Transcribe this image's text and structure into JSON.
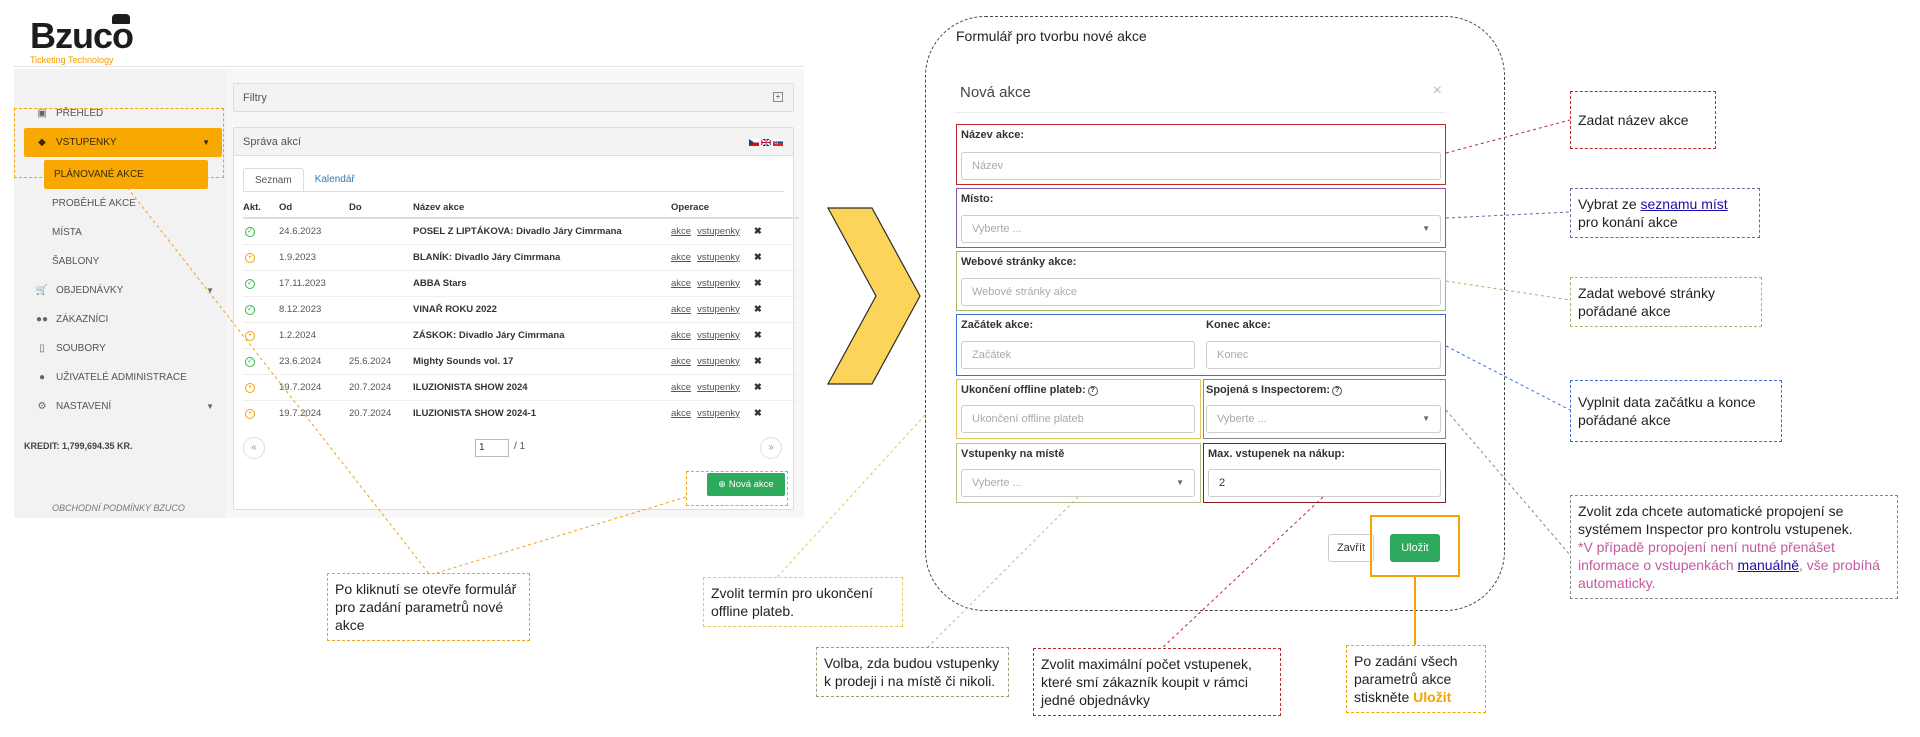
{
  "logo": {
    "name": "Bzuco",
    "tagline": "Ticketing Technology"
  },
  "sidebar": {
    "items": [
      {
        "label": "PŘEHLED",
        "icon": "dashboard-icon"
      },
      {
        "label": "VSTUPENKY",
        "icon": "ticket-icon"
      },
      {
        "label": "PLÁNOVANÉ AKCE"
      },
      {
        "label": "PROBĚHLÉ AKCE"
      },
      {
        "label": "MÍSTA"
      },
      {
        "label": "ŠABLONY"
      },
      {
        "label": "OBJEDNÁVKY",
        "icon": "cart-icon"
      },
      {
        "label": "ZÁKAZNÍCI",
        "icon": "users-icon"
      },
      {
        "label": "SOUBORY",
        "icon": "file-icon"
      },
      {
        "label": "UŽIVATELÉ ADMINISTRACE",
        "icon": "user-icon"
      },
      {
        "label": "NASTAVENÍ",
        "icon": "cogs-icon"
      }
    ],
    "credit": "KREDIT: 1,799,694.35 KR.",
    "terms": "OBCHODNÍ PODMÍNKY BZUCO"
  },
  "filters": {
    "title": "Filtry"
  },
  "events_panel": {
    "title": "Správa akcí",
    "tabs": [
      "Seznam",
      "Kalendář"
    ],
    "columns": [
      "Akt.",
      "Od",
      "Do",
      "Název akce",
      "Operace"
    ],
    "rows": [
      {
        "status": "ok",
        "od": "24.6.2023",
        "do": "",
        "name": "POSEL Z LIPTÁKOVA: Divadlo Járy Cimrmana"
      },
      {
        "status": "warn",
        "od": "1.9.2023",
        "do": "",
        "name": "BLANÍK: Divadlo Járy Cimrmana"
      },
      {
        "status": "ok",
        "od": "17.11.2023",
        "do": "",
        "name": "ABBA Stars"
      },
      {
        "status": "ok",
        "od": "8.12.2023",
        "do": "",
        "name": "VINAŘ ROKU 2022"
      },
      {
        "status": "warn",
        "od": "1.2.2024",
        "do": "",
        "name": "ZÁSKOK: Divadlo Járy Cimrmana"
      },
      {
        "status": "ok",
        "od": "23.6.2024",
        "do": "25.6.2024",
        "name": "Mighty Sounds vol. 17"
      },
      {
        "status": "warn",
        "od": "19.7.2024",
        "do": "20.7.2024",
        "name": "ILUZIONISTA SHOW 2024"
      },
      {
        "status": "warn",
        "od": "19.7.2024",
        "do": "20.7.2024",
        "name": "ILUZIONISTA SHOW 2024-1"
      }
    ],
    "op_akce": "akce",
    "op_vstupenky": "vstupenky",
    "op_delete": "✖",
    "pager": {
      "prev": "«",
      "next": "»",
      "page": "1",
      "of": "/  1"
    },
    "new_button": "Nová akce"
  },
  "form": {
    "caption": "Formulář pro tvorbu nové akce",
    "title": "Nová akce",
    "close": "×",
    "name_label": "Název akce:",
    "name_placeholder": "Název",
    "place_label": "Místo:",
    "place_placeholder": "Vyberte ...",
    "web_label": "Webové stránky akce:",
    "web_placeholder": "Webové stránky akce",
    "start_label": "Začátek akce:",
    "start_placeholder": "Začátek",
    "end_label": "Konec akce:",
    "end_placeholder": "Konec",
    "offline_label": "Ukončení offline plateb:",
    "offline_placeholder": "Ukončení offline plateb",
    "inspector_label": "Spojená s Inspectorem:",
    "inspector_placeholder": "Vyberte ...",
    "onsite_label": "Vstupenky na místě",
    "onsite_placeholder": "Vyberte ...",
    "max_label": "Max. vstupenek na nákup:",
    "max_value": "2",
    "close_button": "Zavřít",
    "save_button": "Uložit"
  },
  "notes": {
    "click_open": "Po kliknutí se otevře formulář pro zadání parametrů nové akce",
    "offline_term": "Zvolit termín pro ukončení offline plateb.",
    "onsite": "Volba, zda budou vstupenky k prodeji i na místě či nikoli.",
    "max_tickets": "Zvolit maximální počet vstupenek, které smí zákazník koupit v rámci jedné objednávky",
    "save_a": "Po zadání všech parametrů akce stiskněte",
    "save_b": "Uložit",
    "name": "Zadat název akce",
    "place_a": "Vybrat ze",
    "place_link": "seznamu míst",
    "place_b": "pro konání akce",
    "web": "Zadat webové stránky pořádané akce",
    "dates": "Vyplnit data začátku a konce pořádané akce",
    "inspector_a": "Zvolit zda chcete automatické propojení se systémem Inspector pro kontrolu vstupenek.",
    "inspector_b": "*V případě propojení není nutné přenášet informace o vstupenkách",
    "inspector_link": "manuálně",
    "inspector_c": ", vše probíhá automaticky."
  },
  "colors": {
    "accent": "#f8a800",
    "success": "#2eaa5c",
    "name_box": "#c0272d",
    "place_box": "#7b5fa6",
    "web_box": "#9fb86a",
    "dates_box": "#3b6fd6",
    "offline_box": "#e6c657",
    "inspector_box": "#888888",
    "max_box": "#8b1a1a",
    "pink_note": "#c45aa0"
  }
}
